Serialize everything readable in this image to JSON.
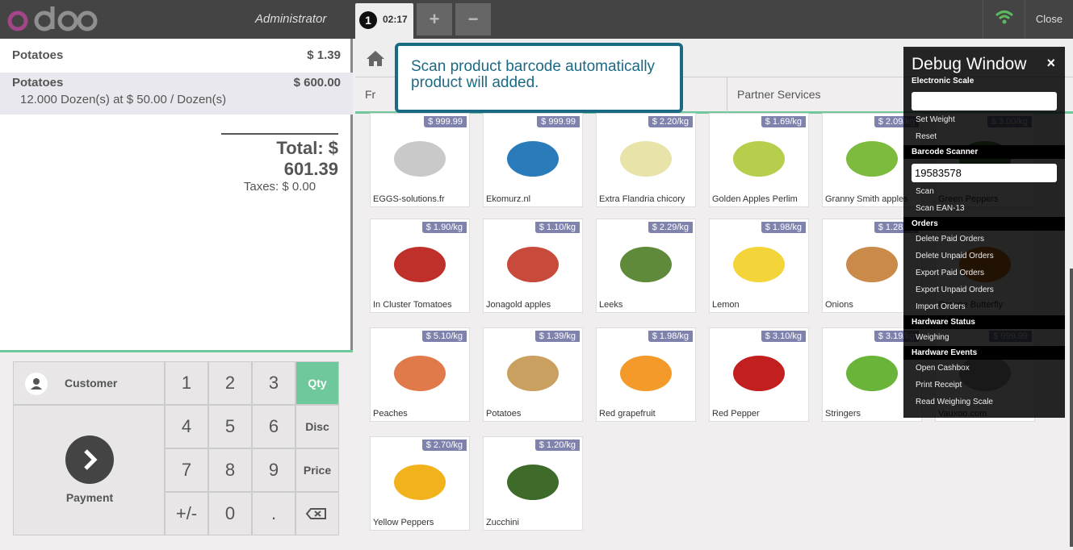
{
  "header": {
    "brand": "odoo",
    "user": "Administrator",
    "order_number": "1",
    "order_time": "02:17",
    "add_label": "+",
    "remove_label": "−",
    "close_label": "Close"
  },
  "order": {
    "lines": [
      {
        "name": "Potatoes",
        "price": "$ 1.39"
      },
      {
        "name": "Potatoes",
        "price": "$ 600.00",
        "info": "12.000 Dozen(s) at $ 50.00 / Dozen(s)"
      }
    ],
    "total": "Total: $ 601.39",
    "taxes": "Taxes: $ 0.00"
  },
  "numpad": {
    "customer": "Customer",
    "payment": "Payment",
    "keys": [
      "1",
      "2",
      "3",
      "4",
      "5",
      "6",
      "7",
      "8",
      "9",
      "+/-",
      "0",
      "."
    ],
    "modes": [
      "Qty",
      "Disc",
      "Price"
    ]
  },
  "categories": [
    "Fr",
    "Partner Services"
  ],
  "callout": "Scan product barcode automatically product will added.",
  "products": [
    {
      "name": "EGGS-solutions.fr",
      "price": "$ 999.99"
    },
    {
      "name": "Ekomurz.nl",
      "price": "$ 999.99"
    },
    {
      "name": "Extra Flandria chicory",
      "price": "$ 2.20/kg"
    },
    {
      "name": "Golden Apples Perlim",
      "price": "$ 1.69/kg"
    },
    {
      "name": "Granny Smith apples",
      "price": "$ 2.09/kg"
    },
    {
      "name": "Green Peppers",
      "price": "$ 3.00/kg"
    },
    {
      "name": "In Cluster Tomatoes",
      "price": "$ 1.90/kg"
    },
    {
      "name": "Jonagold apples",
      "price": "$ 1.10/kg"
    },
    {
      "name": "Leeks",
      "price": "$ 2.29/kg"
    },
    {
      "name": "Lemon",
      "price": "$ 1.98/kg"
    },
    {
      "name": "Onions",
      "price": "$ 1.28/kg"
    },
    {
      "name": "Orange Butterfly",
      "price": ""
    },
    {
      "name": "Peaches",
      "price": "$ 5.10/kg"
    },
    {
      "name": "Potatoes",
      "price": "$ 1.39/kg"
    },
    {
      "name": "Red grapefruit",
      "price": "$ 1.98/kg"
    },
    {
      "name": "Red Pepper",
      "price": "$ 3.10/kg"
    },
    {
      "name": "Stringers",
      "price": "$ 3.19/kg"
    },
    {
      "name": "Vauxoo.com",
      "price": "$ 999.99"
    },
    {
      "name": "Yellow Peppers",
      "price": "$ 2.70/kg"
    },
    {
      "name": "Zucchini",
      "price": "$ 1.20/kg"
    }
  ],
  "debug": {
    "title": "Debug Window",
    "close": "×",
    "scale_section": "Electronic Scale",
    "scale_value": "",
    "set_weight": "Set Weight",
    "reset": "Reset",
    "barcode_section": "Barcode Scanner",
    "barcode_value": "19583578",
    "scan": "Scan",
    "scan_ean": "Scan EAN-13",
    "orders_section": "Orders",
    "delete_paid": "Delete Paid Orders",
    "delete_unpaid": "Delete Unpaid Orders",
    "export_paid": "Export Paid Orders",
    "export_unpaid": "Export Unpaid Orders",
    "import_orders": "Import Orders",
    "hw_status_section": "Hardware Status",
    "weighing": "Weighing",
    "hw_events_section": "Hardware Events",
    "open_cashbox": "Open Cashbox",
    "print_receipt": "Print Receipt",
    "read_scale": "Read Weighing Scale"
  },
  "colors": {
    "accent": "#6ec89b",
    "callout": "#1a6a84",
    "price_tag": "#7f82ac",
    "topbar": "#444444"
  }
}
